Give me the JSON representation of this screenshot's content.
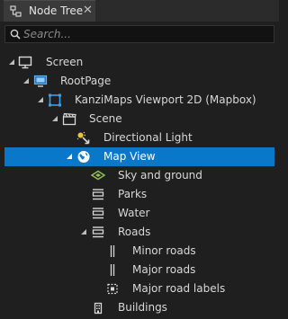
{
  "panel": {
    "tab_title": "Node Tree",
    "close_glyph": "✕",
    "search_placeholder": "Search...",
    "search_value": ""
  },
  "tree": {
    "nodes": [
      {
        "label": "Screen",
        "icon": "screen-icon",
        "expanded": true,
        "selected": false
      },
      {
        "label": "RootPage",
        "icon": "page-icon",
        "expanded": true,
        "selected": false
      },
      {
        "label": "KanziMaps Viewport 2D (Mapbox)",
        "icon": "viewport-icon",
        "expanded": true,
        "selected": false
      },
      {
        "label": "Scene",
        "icon": "scene-icon",
        "expanded": true,
        "selected": false
      },
      {
        "label": "Directional Light",
        "icon": "directional-light-icon",
        "expanded": false,
        "selected": false
      },
      {
        "label": "Map View",
        "icon": "globe-icon",
        "expanded": true,
        "selected": true
      },
      {
        "label": "Sky and ground",
        "icon": "sky-ground-icon",
        "expanded": false,
        "selected": false
      },
      {
        "label": "Parks",
        "icon": "layer-icon",
        "expanded": false,
        "selected": false
      },
      {
        "label": "Water",
        "icon": "layer-icon",
        "expanded": false,
        "selected": false
      },
      {
        "label": "Roads",
        "icon": "layer-icon",
        "expanded": true,
        "selected": false
      },
      {
        "label": "Minor roads",
        "icon": "line-layer-icon",
        "expanded": false,
        "selected": false
      },
      {
        "label": "Major roads",
        "icon": "line-layer-icon",
        "expanded": false,
        "selected": false
      },
      {
        "label": "Major road labels",
        "icon": "symbol-layer-icon",
        "expanded": false,
        "selected": false
      },
      {
        "label": "Buildings",
        "icon": "buildings-icon",
        "expanded": false,
        "selected": false
      }
    ]
  },
  "colors": {
    "background": "#1f1f1f",
    "selection": "#0a78c8",
    "icon_blue": "#3a9fe6",
    "icon_yellow": "#e8c24a",
    "icon_green": "#8fbf5a"
  }
}
